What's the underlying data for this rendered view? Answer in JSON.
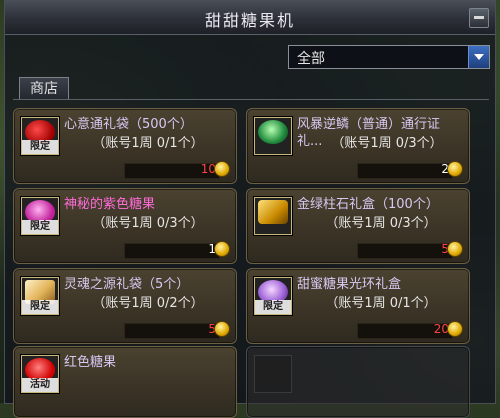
{
  "window": {
    "title": "甜甜糖果机"
  },
  "filter": {
    "selected": "全部"
  },
  "tabs": [
    {
      "label": "商店"
    }
  ],
  "items": [
    {
      "name": "心意通礼袋（500个）",
      "limit": "（账号1周 0/1个）",
      "price": "10",
      "tag": "限定",
      "price_color": "red",
      "name_color": "normal",
      "icon": "red-bag-icon"
    },
    {
      "name": "风暴逆鳞（普通）通行证礼...",
      "limit": "（账号1周 0/3个）",
      "price": "2",
      "tag": "限定",
      "price_color": "white",
      "name_color": "normal",
      "icon": "green-scale-icon"
    },
    {
      "name": "神秘的紫色糖果",
      "limit": "（账号1周 0/3个）",
      "price": "1",
      "tag": "限定",
      "price_color": "white",
      "name_color": "pink",
      "icon": "purple-candy-icon"
    },
    {
      "name": "金绿柱石礼盒（100个）",
      "limit": "（账号1周 0/3个）",
      "price": "5",
      "tag": "限定",
      "price_color": "red",
      "name_color": "normal",
      "icon": "gold-gem-box-icon"
    },
    {
      "name": "灵魂之源礼袋（5个）",
      "limit": "（账号1周 0/2个）",
      "price": "5",
      "tag": "限定",
      "price_color": "red",
      "name_color": "normal",
      "icon": "soul-bag-icon"
    },
    {
      "name": "甜蜜糖果光环礼盒",
      "limit": "（账号1周 0/1个）",
      "price": "20",
      "tag": "限定",
      "price_color": "red",
      "name_color": "normal",
      "icon": "candy-aura-box-icon"
    },
    {
      "name": "红色糖果",
      "limit": "",
      "price": "",
      "tag": "活动",
      "price_color": "white",
      "name_color": "normal",
      "icon": "red-candy-icon"
    }
  ]
}
